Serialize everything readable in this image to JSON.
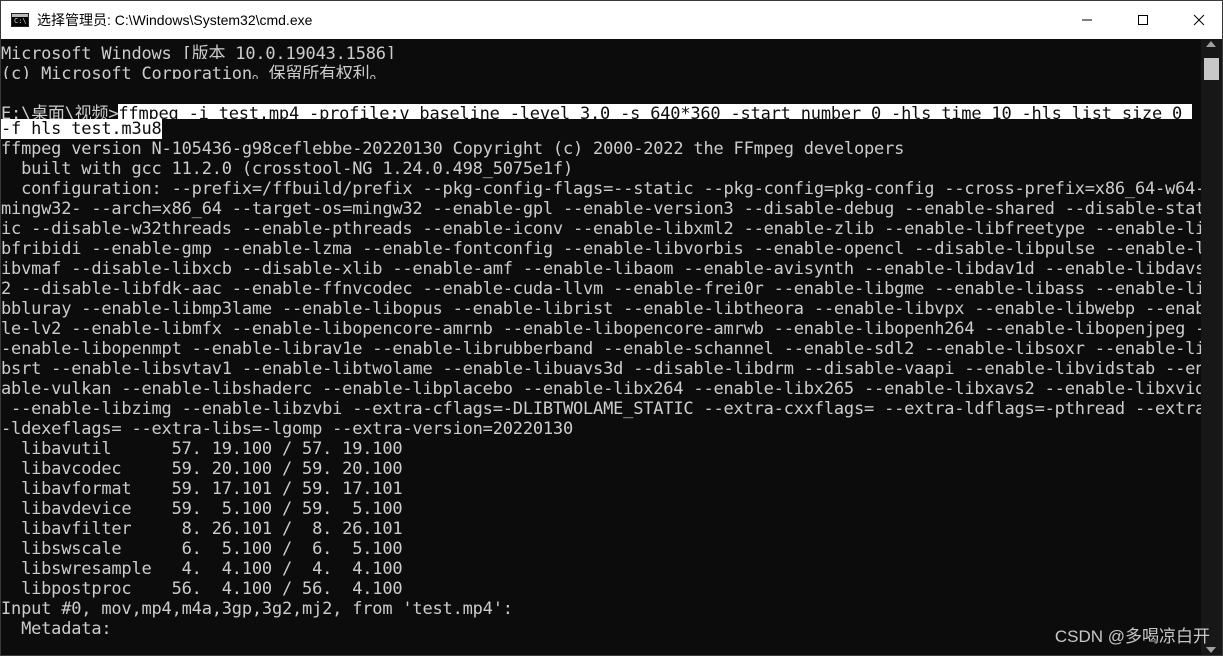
{
  "window": {
    "title": "选择管理员: C:\\Windows\\System32\\cmd.exe",
    "icon": "cmd-icon"
  },
  "console": {
    "lines": [
      "Microsoft Windows [版本 10.0.19043.1586]",
      "(c) Microsoft Corporation。保留所有权利。",
      "",
      "",
      "-f hls test.m3u8",
      "ffmpeg version N-105436-g98ceflebbe-20220130 Copyright (c) 2000-2022 the FFmpeg developers",
      "  built with gcc 11.2.0 (crosstool-NG 1.24.0.498_5075e1f)",
      "  configuration: --prefix=/ffbuild/prefix --pkg-config-flags=--static --pkg-config=pkg-config --cross-prefix=x86_64-w64-",
      "mingw32- --arch=x86_64 --target-os=mingw32 --enable-gpl --enable-version3 --disable-debug --enable-shared --disable-stat",
      "ic --disable-w32threads --enable-pthreads --enable-iconv --enable-libxml2 --enable-zlib --enable-libfreetype --enable-li",
      "bfribidi --enable-gmp --enable-lzma --enable-fontconfig --enable-libvorbis --enable-opencl --disable-libpulse --enable-l",
      "ibvmaf --disable-libxcb --disable-xlib --enable-amf --enable-libaom --enable-avisynth --enable-libdav1d --enable-libdavs",
      "2 --disable-libfdk-aac --enable-ffnvcodec --enable-cuda-llvm --enable-frei0r --enable-libgme --enable-libass --enable-li",
      "bbluray --enable-libmp3lame --enable-libopus --enable-librist --enable-libtheora --enable-libvpx --enable-libwebp --enab",
      "le-lv2 --enable-libmfx --enable-libopencore-amrnb --enable-libopencore-amrwb --enable-libopenh264 --enable-libopenjpeg -",
      "-enable-libopenmpt --enable-librav1e --enable-librubberband --enable-schannel --enable-sdl2 --enable-libsoxr --enable-li",
      "bsrt --enable-libsvtav1 --enable-libtwolame --enable-libuavs3d --disable-libdrm --disable-vaapi --enable-libvidstab --en",
      "able-vulkan --enable-libshaderc --enable-libplacebo --enable-libx264 --enable-libx265 --enable-libxavs2 --enable-libxvid",
      " --enable-libzimg --enable-libzvbi --extra-cflags=-DLIBTWOLAME_STATIC --extra-cxxflags= --extra-ldflags=-pthread --extra",
      "-ldexeflags= --extra-libs=-lgomp --extra-version=20220130",
      "  libavutil      57. 19.100 / 57. 19.100",
      "  libavcodec     59. 20.100 / 59. 20.100",
      "  libavformat    59. 17.101 / 59. 17.101",
      "  libavdevice    59.  5.100 / 59.  5.100",
      "  libavfilter     8. 26.101 /  8. 26.101",
      "  libswscale      6.  5.100 /  6.  5.100",
      "  libswresample   4.  4.100 /  4.  4.100",
      "  libpostproc    56.  4.100 / 56.  4.100",
      "Input #0, mov,mp4,m4a,3gp,3g2,mj2, from 'test.mp4':",
      "  Metadata:"
    ],
    "prompt": "E:\\桌面\\视频>",
    "command": "ffmpeg -i test.mp4 -profile:v baseline -level 3.0 -s 640*360 -start_number 0 -hls_time 10 -hls_list_size 0 "
  },
  "watermark": "CSDN @多喝凉白开",
  "colors": {
    "background": "#0c0c0c",
    "text": "#cccccc",
    "selection": "#ffffff",
    "titlebar": "#ffffff"
  }
}
